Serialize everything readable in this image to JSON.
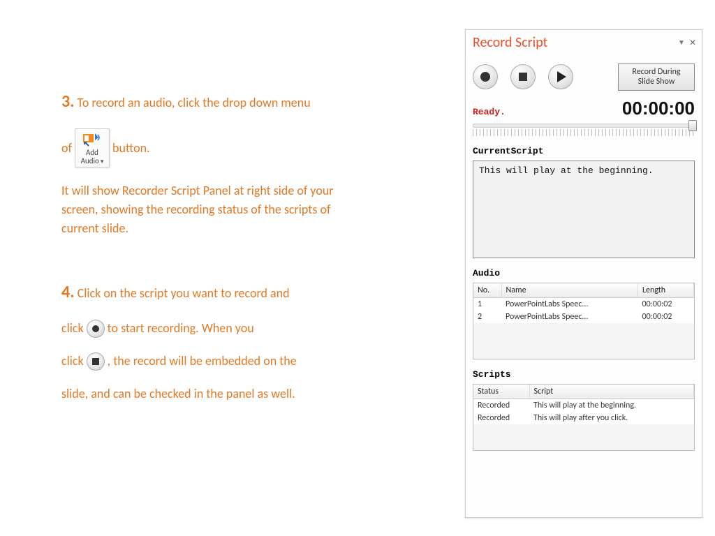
{
  "instructions": {
    "step3_num": "3.",
    "step3_a": "To record an audio, click the drop down menu",
    "step3_b_of": "of",
    "step3_b_button": " button.",
    "add_audio_line1": "Add",
    "add_audio_line2": "Audio",
    "step3_c": "It will show Recorder Script Panel at right side of your screen, showing the recording status of the scripts of current slide.",
    "step4_num": "4.",
    "step4_a": "Click on the script you want to record and",
    "step4_b_click1": "click",
    "step4_b_start": " to start recording. When you",
    "step4_c_click2": "click",
    "step4_c_rest": ", the record will be embedded on the",
    "step4_d": "slide, and can be checked in the panel as well."
  },
  "panel": {
    "title": "Record Script",
    "record_during_line1": "Record During",
    "record_during_line2": "Slide Show",
    "status": "Ready.",
    "timecode": "00:00:00",
    "current_script_label": "CurrentScript",
    "current_script_text": "This will play at the beginning.",
    "audio_label": "Audio",
    "scripts_label": "Scripts",
    "audio_headers": {
      "no": "No.",
      "name": "Name",
      "length": "Length"
    },
    "audio_rows": [
      {
        "no": "1",
        "name": "PowerPointLabs Speec...",
        "length": "00:00:02"
      },
      {
        "no": "2",
        "name": "PowerPointLabs Speec...",
        "length": "00:00:02"
      }
    ],
    "scripts_headers": {
      "status": "Status",
      "script": "Script"
    },
    "scripts_rows": [
      {
        "status": "Recorded",
        "script": "This will play at the beginning."
      },
      {
        "status": "Recorded",
        "script": "This will play after you click."
      }
    ]
  }
}
